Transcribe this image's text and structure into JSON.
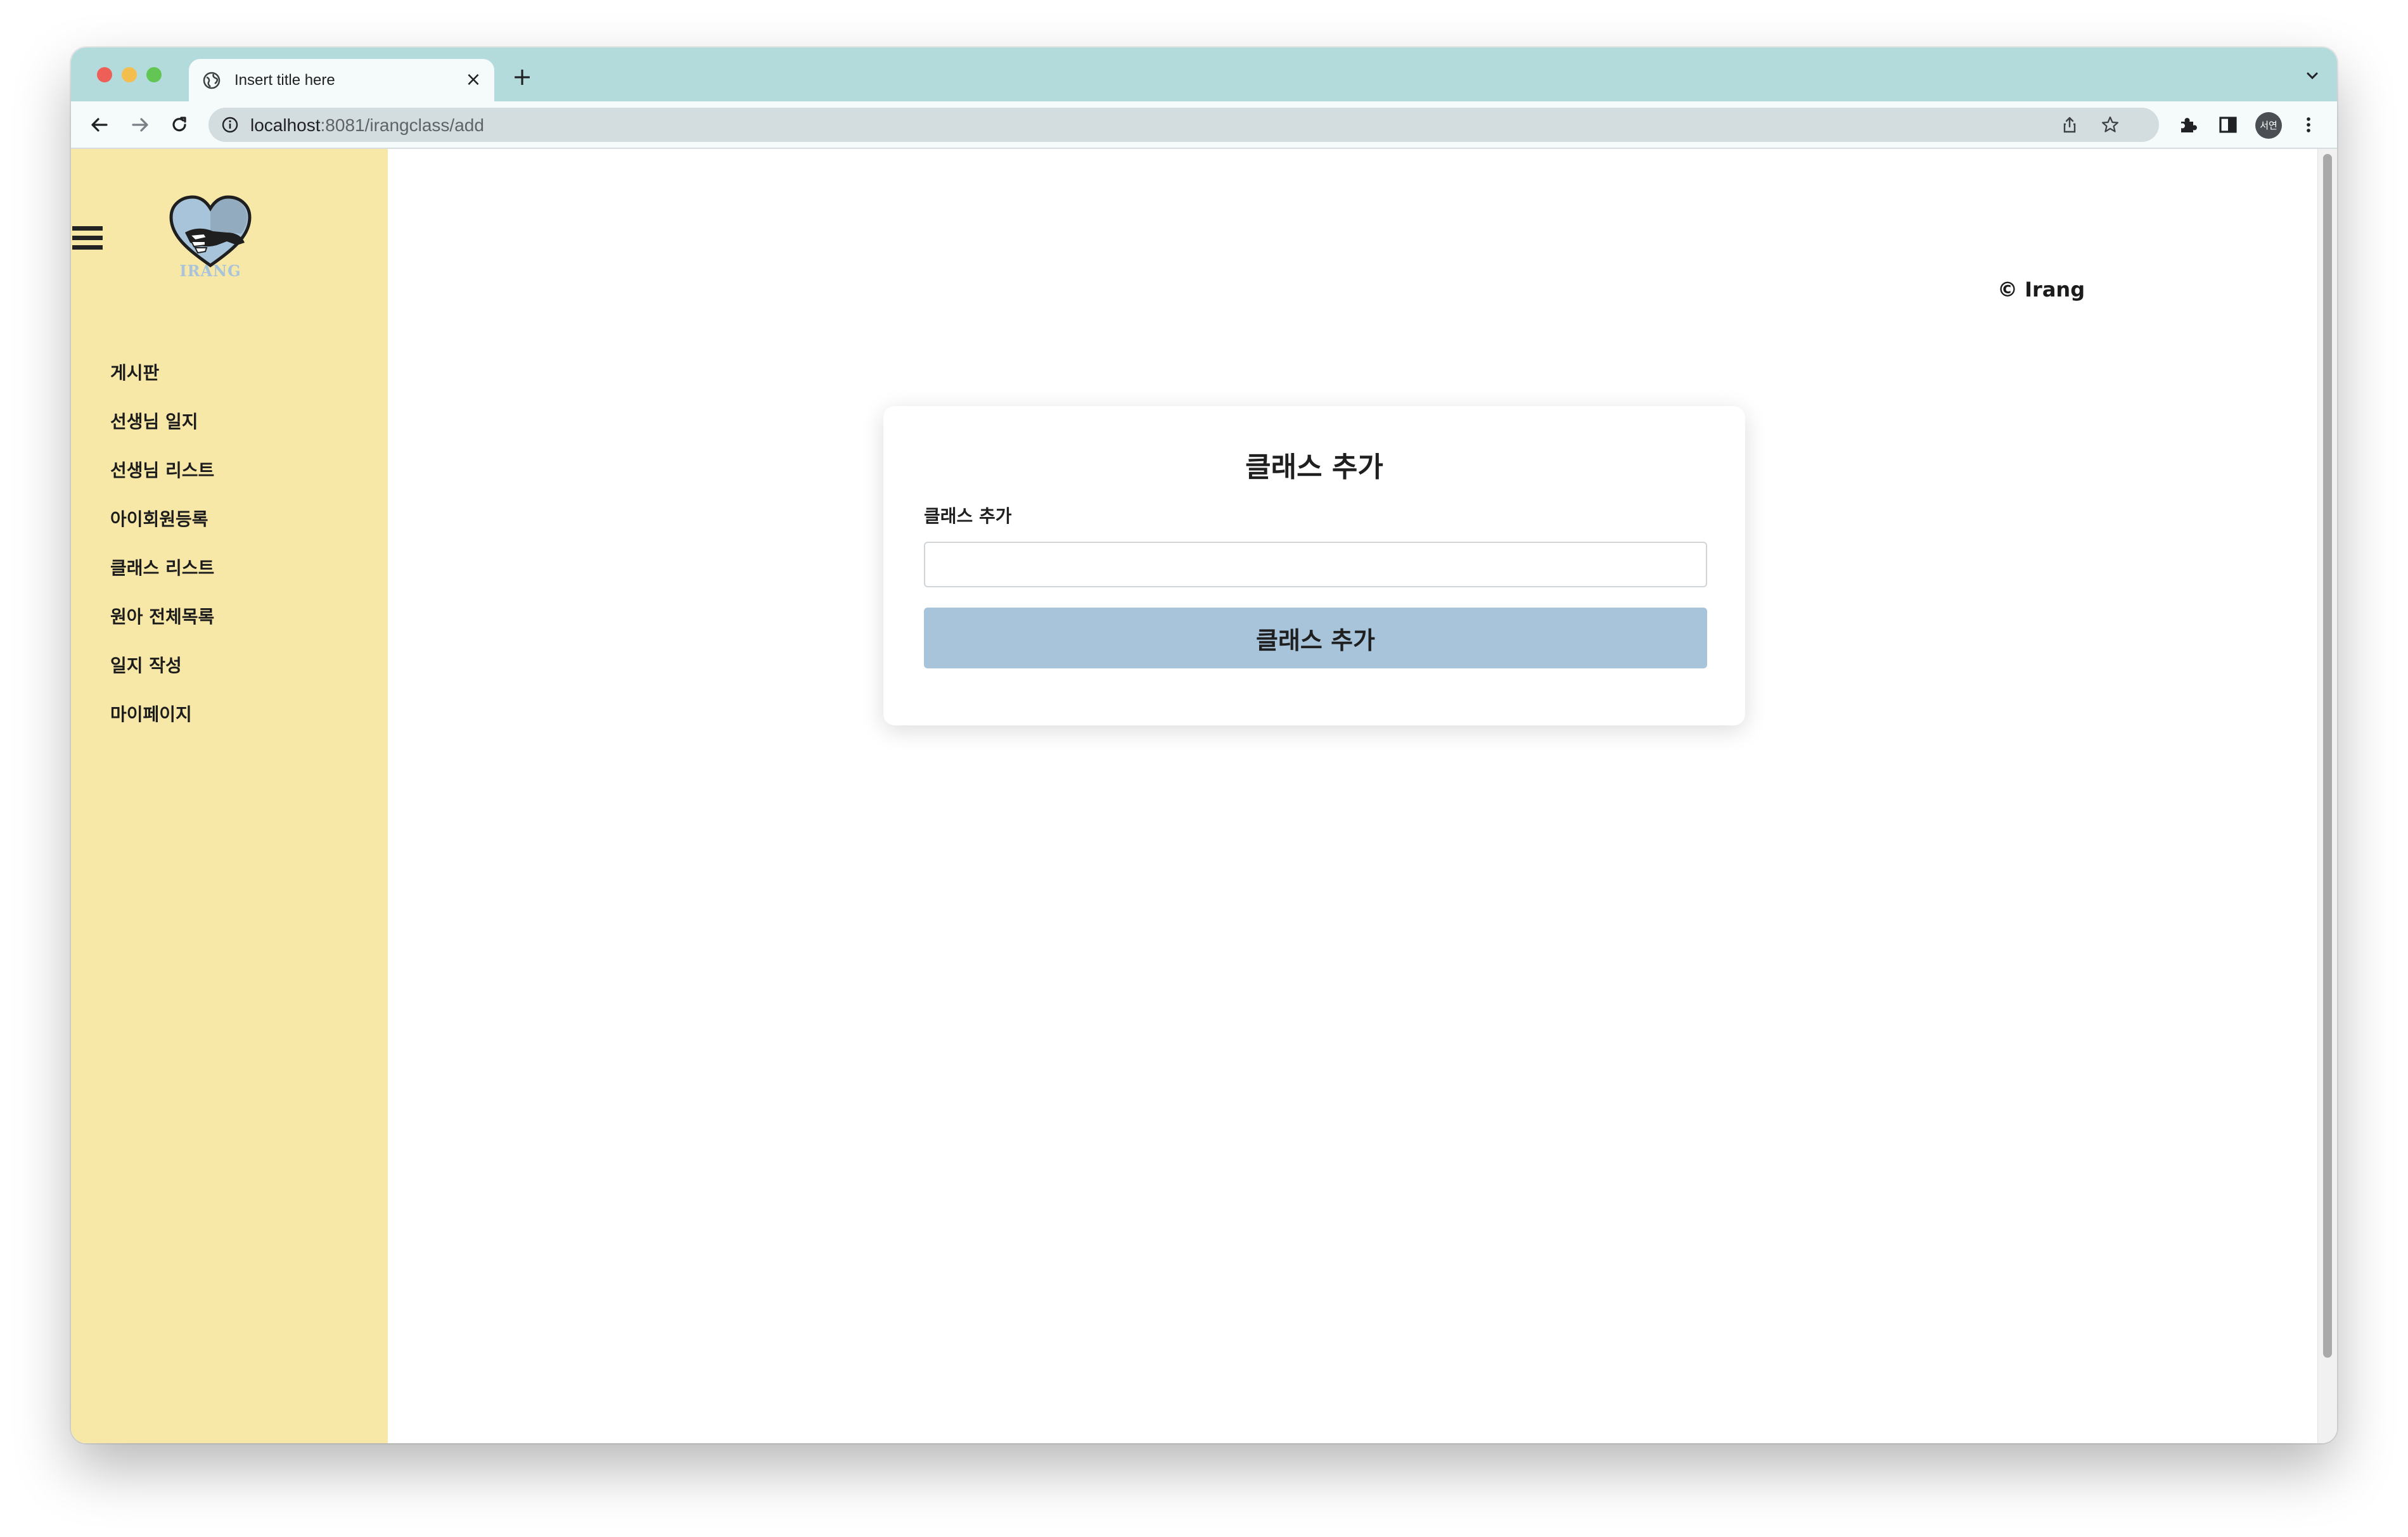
{
  "browser": {
    "tab": {
      "title": "Insert title here",
      "close": "×"
    },
    "new_tab": "+",
    "address": {
      "host": "localhost",
      "path": ":8081/irangclass/add"
    },
    "profile_initials": "서연"
  },
  "sidebar": {
    "logo_text": "IRANG",
    "items": [
      {
        "label": "게시판"
      },
      {
        "label": "선생님 일지"
      },
      {
        "label": "선생님 리스트"
      },
      {
        "label": "아이회원등록"
      },
      {
        "label": "클래스 리스트"
      },
      {
        "label": "원아 전체목록"
      },
      {
        "label": "일지 작성"
      },
      {
        "label": "마이페이지"
      }
    ]
  },
  "header": {
    "copyright": "© Irang"
  },
  "form": {
    "title": "클래스 추가",
    "field_label": "클래스 추가",
    "field_value": "",
    "submit_label": "클래스 추가"
  },
  "colors": {
    "tabstrip": "#b4dbdb",
    "sidebar": "#f7e8a8",
    "accent": "#a7c4da"
  }
}
